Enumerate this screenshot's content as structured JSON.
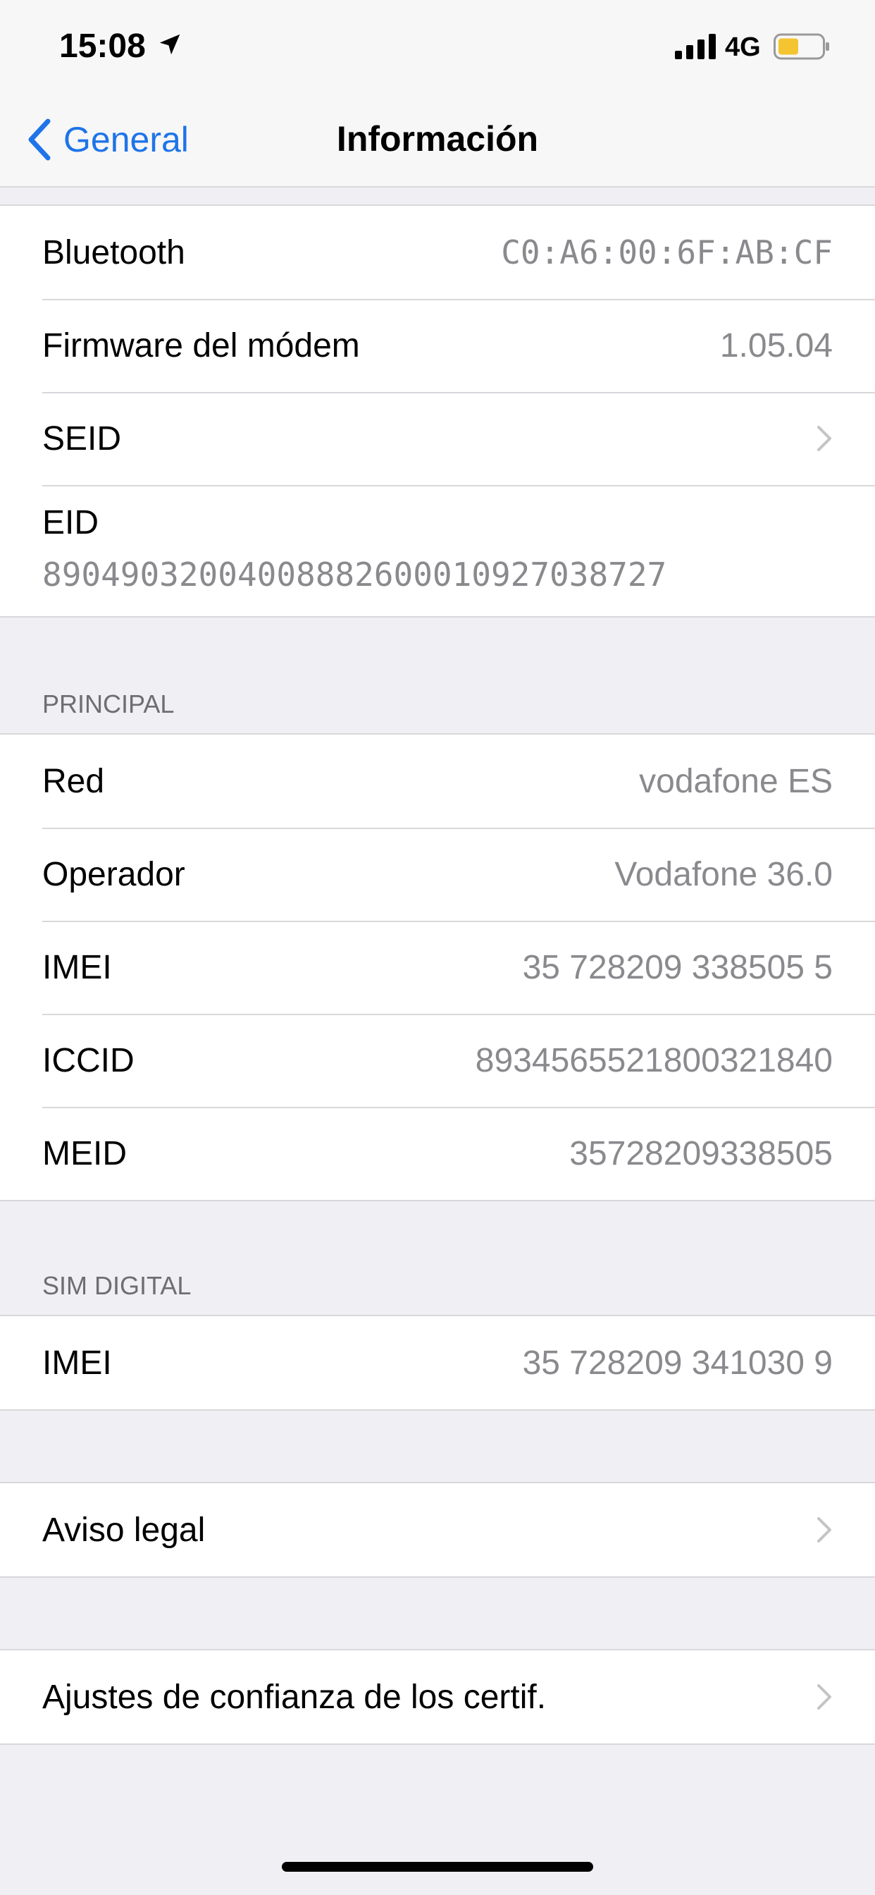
{
  "status_bar": {
    "time": "15:08",
    "network": "4G",
    "icons": [
      "location-arrow-icon",
      "signal-bars-icon",
      "battery-icon"
    ],
    "battery_color": "#f4c531"
  },
  "nav": {
    "back_label": "General",
    "title": "Información",
    "accent_color": "#1e74e8"
  },
  "top_section": {
    "bluetooth": {
      "label": "Bluetooth",
      "value": "C0:A6:00:6F:AB:CF"
    },
    "modem": {
      "label": "Firmware del módem",
      "value": "1.05.04"
    },
    "seid": {
      "label": "SEID"
    },
    "eid": {
      "label": "EID",
      "value": "89049032004008882600010927038727"
    }
  },
  "principal": {
    "header": "PRINCIPAL",
    "rows": [
      {
        "label": "Red",
        "value": "vodafone ES"
      },
      {
        "label": "Operador",
        "value": "Vodafone 36.0"
      },
      {
        "label": "IMEI",
        "value": "35 728209 338505 5"
      },
      {
        "label": "ICCID",
        "value": "8934565521800321840"
      },
      {
        "label": "MEID",
        "value": "35728209338505"
      }
    ]
  },
  "sim_digital": {
    "header": "SIM DIGITAL",
    "imei": {
      "label": "IMEI",
      "value": "35 728209 341030 9"
    }
  },
  "legal": {
    "label": "Aviso legal"
  },
  "cert": {
    "label": "Ajustes de confianza de los certif."
  }
}
